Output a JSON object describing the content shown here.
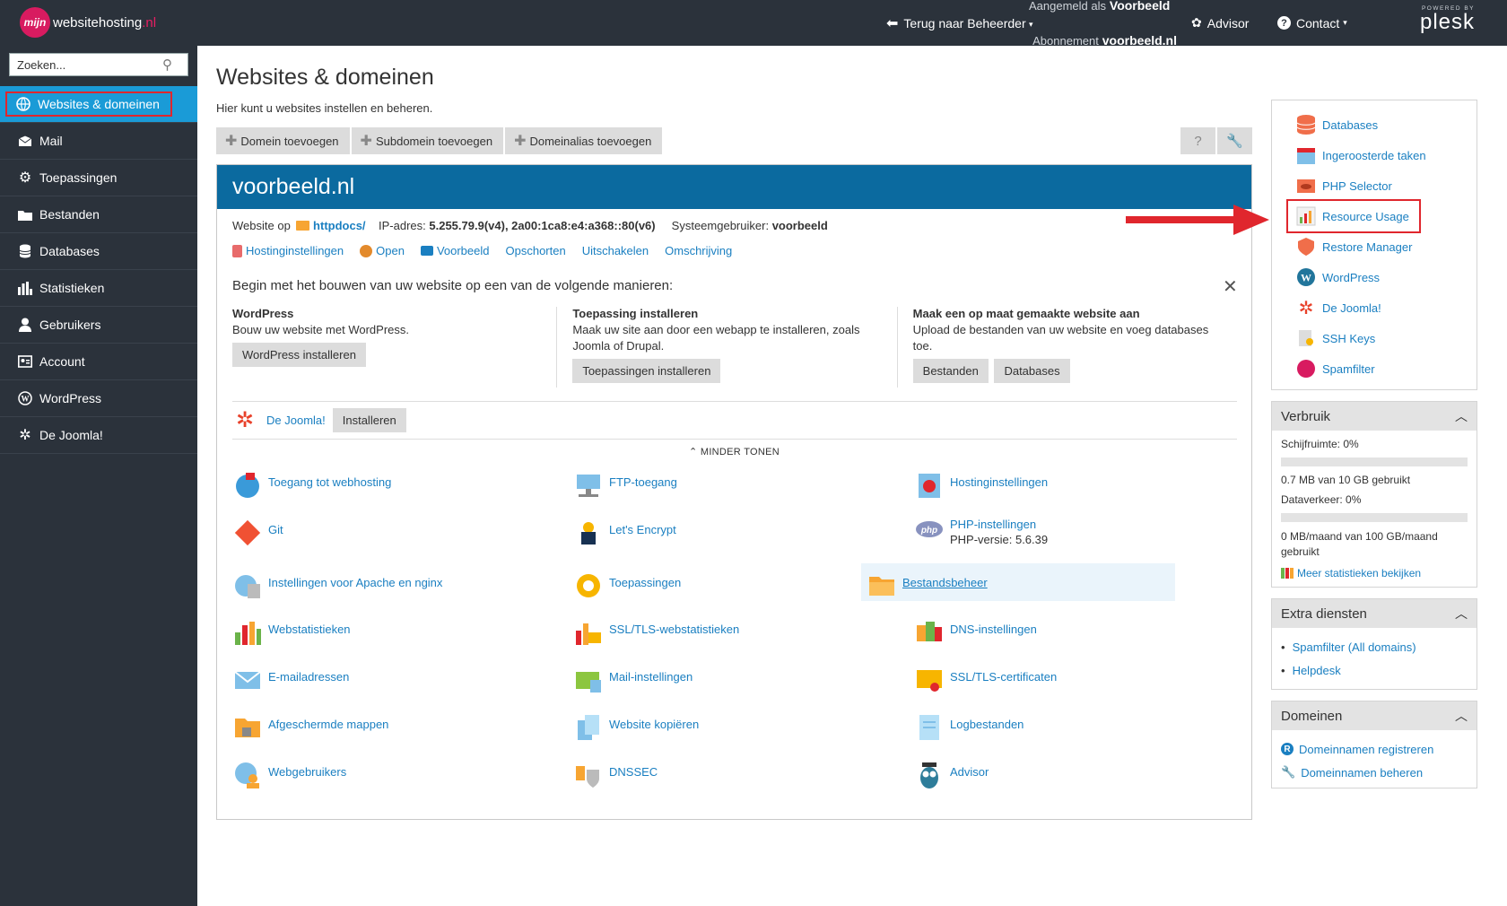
{
  "topbar": {
    "logo_mark": "mijn",
    "logo_name": "websitehosting",
    "logo_tld": ".nl",
    "back_label": "Terug naar Beheerder",
    "logged_in_as_label": "Aangemeld als",
    "user": "Voorbeeld",
    "subscription_label": "Abonnement",
    "subscription": "voorbeeld.nl",
    "advisor": "Advisor",
    "contact": "Contact",
    "powered_by": "POWERED BY",
    "plesk": "plesk"
  },
  "sidebar": {
    "search_placeholder": "Zoeken...",
    "items": [
      {
        "label": "Websites & domeinen",
        "icon": "globe-icon"
      },
      {
        "label": "Mail",
        "icon": "mail-icon"
      },
      {
        "label": "Toepassingen",
        "icon": "gear-icon"
      },
      {
        "label": "Bestanden",
        "icon": "folder-icon"
      },
      {
        "label": "Databases",
        "icon": "database-icon"
      },
      {
        "label": "Statistieken",
        "icon": "bar-chart-icon"
      },
      {
        "label": "Gebruikers",
        "icon": "user-icon"
      },
      {
        "label": "Account",
        "icon": "account-icon"
      },
      {
        "label": "WordPress",
        "icon": "wordpress-icon"
      },
      {
        "label": "De Joomla!",
        "icon": "joomla-icon"
      }
    ]
  },
  "main": {
    "title": "Websites & domeinen",
    "subtitle": "Hier kunt u websites instellen en beheren.",
    "toolbar": [
      "Domein toevoegen",
      "Subdomein toevoegen",
      "Domeinalias toevoegen"
    ],
    "help_glyph": "?",
    "domain": {
      "name": "voorbeeld.nl",
      "website_on": "Website op",
      "docroot": "httpdocs/",
      "ip_label": "IP-adres:",
      "ip": "5.255.79.9(v4), 2a00:1ca8:e4:a368::80(v6)",
      "sysuser_label": "Systeemgebruiker:",
      "sysuser": "voorbeeld",
      "links": [
        "Hostinginstellingen",
        "Open",
        "Voorbeeld",
        "Opschorten",
        "Uitschakelen",
        "Omschrijving"
      ],
      "build_title": "Begin met het bouwen van uw website op een van de volgende manieren:",
      "close_glyph": "✕",
      "options": [
        {
          "title": "WordPress",
          "desc": "Bouw uw website met WordPress.",
          "buttons": [
            "WordPress installeren"
          ]
        },
        {
          "title": "Toepassing installeren",
          "desc": "Maak uw site aan door een webapp te installeren, zoals Joomla of Drupal.",
          "buttons": [
            "Toepassingen installeren"
          ]
        },
        {
          "title": "Maak een op maat gemaakte website aan",
          "desc": "Upload de bestanden van uw website en voeg databases toe.",
          "buttons": [
            "Bestanden",
            "Databases"
          ]
        }
      ],
      "joomla_link": "De Joomla!",
      "joomla_button": "Installeren",
      "show_less": "MINDER TONEN",
      "tools": [
        [
          "Toegang tot webhosting",
          "FTP-toegang",
          "Hostinginstellingen"
        ],
        [
          "Git",
          "Let's Encrypt",
          "PHP-instellingen"
        ],
        [
          "Instellingen voor Apache en nginx",
          "Toepassingen",
          "Bestandsbeheer"
        ],
        [
          "Webstatistieken",
          "SSL/TLS-webstatistieken",
          "DNS-instellingen"
        ],
        [
          "E-mailadressen",
          "Mail-instellingen",
          "SSL/TLS-certificaten"
        ],
        [
          "Afgeschermde mappen",
          "Website kopiëren",
          "Logbestanden"
        ],
        [
          "Webgebruikers",
          "DNSSEC",
          "Advisor"
        ]
      ],
      "php_version": "PHP-versie: 5.6.39"
    }
  },
  "right": {
    "links": [
      "Databases",
      "Ingeroosterde taken",
      "PHP Selector",
      "Resource Usage",
      "Restore Manager",
      "WordPress",
      "De Joomla!",
      "SSH Keys",
      "Spamfilter"
    ],
    "usage": {
      "title": "Verbruik",
      "disk_label": "Schijfruimte: 0%",
      "disk_value": 0,
      "disk_text": "0.7 MB van 10 GB gebruikt",
      "traffic_label": "Dataverkeer: 0%",
      "traffic_value": 0,
      "traffic_text": "0 MB/maand van 100 GB/maand gebruikt",
      "more": "Meer statistieken bekijken"
    },
    "extra": {
      "title": "Extra diensten",
      "items": [
        "Spamfilter (All domains)",
        "Helpdesk"
      ]
    },
    "domains": {
      "title": "Domeinen",
      "items": [
        "Domeinnamen registreren",
        "Domeinnamen beheren"
      ]
    }
  },
  "colors": {
    "topbar": "#2b323b",
    "accent": "#1a9bd7",
    "domain_header": "#0b6a9f",
    "highlight": "#e0262d"
  }
}
